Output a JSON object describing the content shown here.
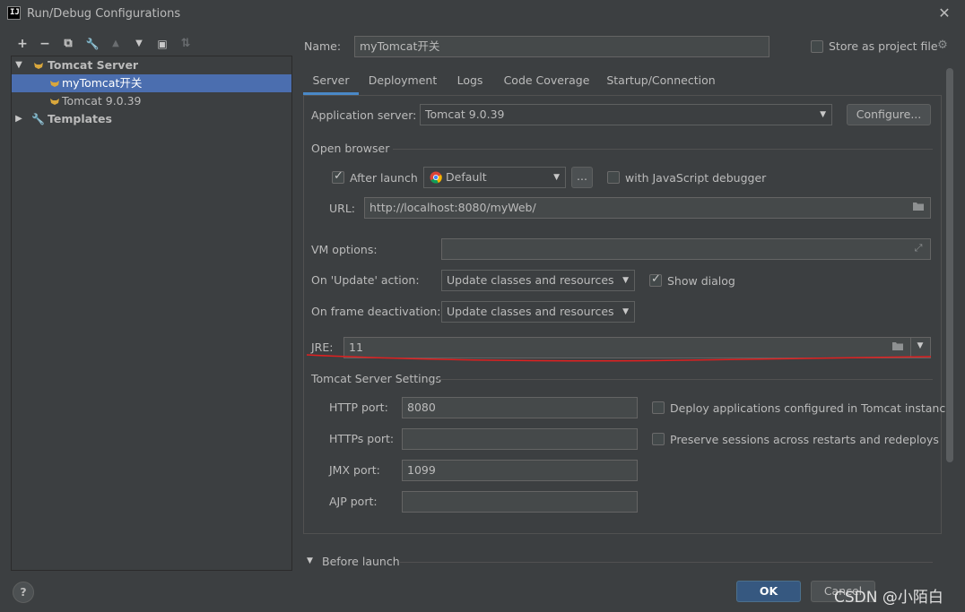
{
  "window": {
    "title": "Run/Debug Configurations",
    "app_icon_text": "IJ"
  },
  "toolbar": {
    "items": [
      {
        "name": "add",
        "glyph": "+"
      },
      {
        "name": "remove",
        "glyph": "−"
      },
      {
        "name": "copy",
        "glyph": "⧉"
      },
      {
        "name": "edit-defaults",
        "glyph": "🔧"
      },
      {
        "name": "move-up",
        "glyph": "▲"
      },
      {
        "name": "move-down",
        "glyph": "▼"
      },
      {
        "name": "new-folder",
        "glyph": "▣"
      },
      {
        "name": "sort",
        "glyph": "⇅"
      }
    ]
  },
  "tree": {
    "group_label": "Tomcat Server",
    "items": [
      {
        "label": "myTomcat开关"
      },
      {
        "label": "Tomcat 9.0.39"
      }
    ],
    "templates_label": "Templates"
  },
  "header": {
    "name_label": "Name:",
    "name_value": "myTomcat开关",
    "store_label": "Store as project file"
  },
  "tabs": [
    "Server",
    "Deployment",
    "Logs",
    "Code Coverage",
    "Startup/Connection"
  ],
  "server": {
    "app_server_label": "Application server:",
    "app_server_value": "Tomcat 9.0.39",
    "configure_label": "Configure...",
    "open_browser_label": "Open browser",
    "after_launch_label": "After launch",
    "browser_value": "Default",
    "ellipsis_label": "...",
    "js_debugger_label": "with JavaScript debugger",
    "url_label": "URL:",
    "url_value": "http://localhost:8080/myWeb/",
    "vm_options_label": "VM options:",
    "vm_options_value": "",
    "on_update_label": "On 'Update' action:",
    "on_update_value": "Update classes and resources",
    "show_dialog_label": "Show dialog",
    "on_frame_label": "On frame deactivation:",
    "on_frame_value": "Update classes and resources",
    "jre_label": "JRE:",
    "jre_value": "11",
    "tomcat_settings_label": "Tomcat Server Settings",
    "http_port_label": "HTTP port:",
    "http_port_value": "8080",
    "https_port_label": "HTTPs port:",
    "https_port_value": "",
    "jmx_port_label": "JMX port:",
    "jmx_port_value": "1099",
    "ajp_port_label": "AJP port:",
    "ajp_port_value": "",
    "deploy_apps_label": "Deploy applications configured in Tomcat instance",
    "preserve_sessions_label": "Preserve sessions across restarts and redeploys"
  },
  "before_launch_label": "Before launch",
  "footer": {
    "ok_label": "OK",
    "cancel_label": "Cancel",
    "help_glyph": "?"
  },
  "watermark": "CSDN @小陌白",
  "colors": {
    "background": "#3c3f41",
    "selection": "#4b6eaf",
    "accent": "#4a88c7",
    "ok_button": "#365880",
    "annotation": "#e02020"
  }
}
